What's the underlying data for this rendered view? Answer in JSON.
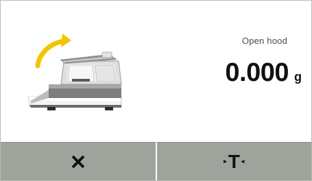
{
  "status": {
    "message": "Open hood"
  },
  "weight": {
    "value": "0.000",
    "unit": "g"
  },
  "buttons": {
    "cancel": {
      "icon": "close-icon"
    },
    "tare": {
      "label": "T",
      "icon": "tare-icon"
    }
  },
  "illustration": {
    "icon": "balance-open-hood-icon",
    "accent": "#f2c400"
  },
  "colors": {
    "button_bar": "#9ea49b",
    "text": "#111111",
    "status_text": "#4a4a4a"
  }
}
